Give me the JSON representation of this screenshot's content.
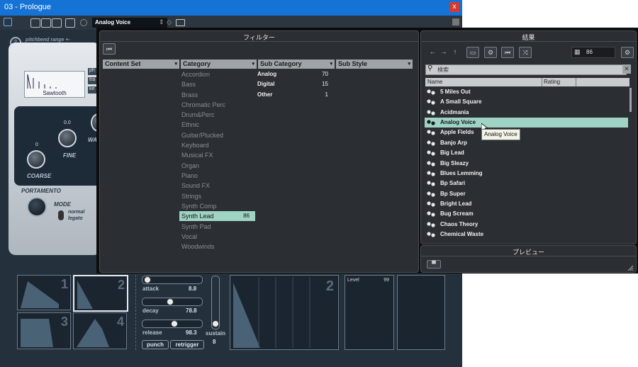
{
  "window": {
    "title": "03 - Prologue",
    "close_glyph": "x"
  },
  "toolbar": {
    "preset_name": "Analog Voice",
    "updown": "⇕",
    "diamond": "◇"
  },
  "synth": {
    "pitchbend_number": "2",
    "pitchbend_label": "pitchbend range +-",
    "waveform_name": "Sawtooth",
    "osc_buttons": [
      "ph",
      "tra",
      "ke"
    ],
    "coarse_value": "0",
    "coarse_label": "COARSE",
    "fine_value": "0.0",
    "fine_label": "FINE",
    "wave_label": "WA",
    "portamento_label": "PORTAMENTO",
    "mode_label": "MODE",
    "mode_normal": "normal",
    "mode_legato": "legato",
    "env_numbers": [
      "1",
      "2",
      "3",
      "4"
    ],
    "attack_label": "attack",
    "attack_value": "8.8",
    "decay_label": "decay",
    "decay_value": "78.8",
    "release_label": "release",
    "release_value": "98.3",
    "sustain_label": "sustain",
    "sustain_value": "8",
    "punch_label": "punch",
    "retrigger_label": "retrigger",
    "graph_number": "2",
    "level_label": "Level",
    "level_value": "99"
  },
  "filter": {
    "title": "フィルター",
    "columns": [
      "Content Set",
      "Category",
      "Sub Category",
      "Sub Style"
    ],
    "categories": [
      {
        "label": "Accordion",
        "count": ""
      },
      {
        "label": "Bass",
        "count": ""
      },
      {
        "label": "Brass",
        "count": ""
      },
      {
        "label": "Chromatic Perc",
        "count": ""
      },
      {
        "label": "Drum&Perc",
        "count": ""
      },
      {
        "label": "Ethnic",
        "count": ""
      },
      {
        "label": "Guitar/Plucked",
        "count": ""
      },
      {
        "label": "Keyboard",
        "count": ""
      },
      {
        "label": "Musical FX",
        "count": ""
      },
      {
        "label": "Organ",
        "count": ""
      },
      {
        "label": "Piano",
        "count": ""
      },
      {
        "label": "Sound FX",
        "count": ""
      },
      {
        "label": "Strings",
        "count": ""
      },
      {
        "label": "Synth Comp",
        "count": ""
      },
      {
        "label": "Synth Lead",
        "count": "86"
      },
      {
        "label": "Synth Pad",
        "count": ""
      },
      {
        "label": "Vocal",
        "count": ""
      },
      {
        "label": "Woodwinds",
        "count": ""
      }
    ],
    "subcategories": [
      {
        "label": "Analog",
        "count": "70"
      },
      {
        "label": "Digital",
        "count": "15"
      },
      {
        "label": "Other",
        "count": "1"
      }
    ]
  },
  "results": {
    "title": "結果",
    "result_count": "86",
    "search_placeholder": "検索",
    "col_name": "Name",
    "col_rating": "Rating",
    "items": [
      "5 Miles Out",
      "A Small Square",
      "Acidmania",
      "Analog Voice",
      "Apple Fields",
      "Banjo Arp",
      "Big Lead",
      "Big Sleazy",
      "Blues Lemming",
      "Bp Safari",
      "Bp Super",
      "Bright Lead",
      "Bug Scream",
      "Chaos Theory",
      "Chemical Waste"
    ],
    "tooltip": "Analog Voice"
  },
  "preview": {
    "title": "プレビュー"
  },
  "colors": {
    "accent": "#9fd3c3",
    "titlebar": "#1673d6"
  }
}
